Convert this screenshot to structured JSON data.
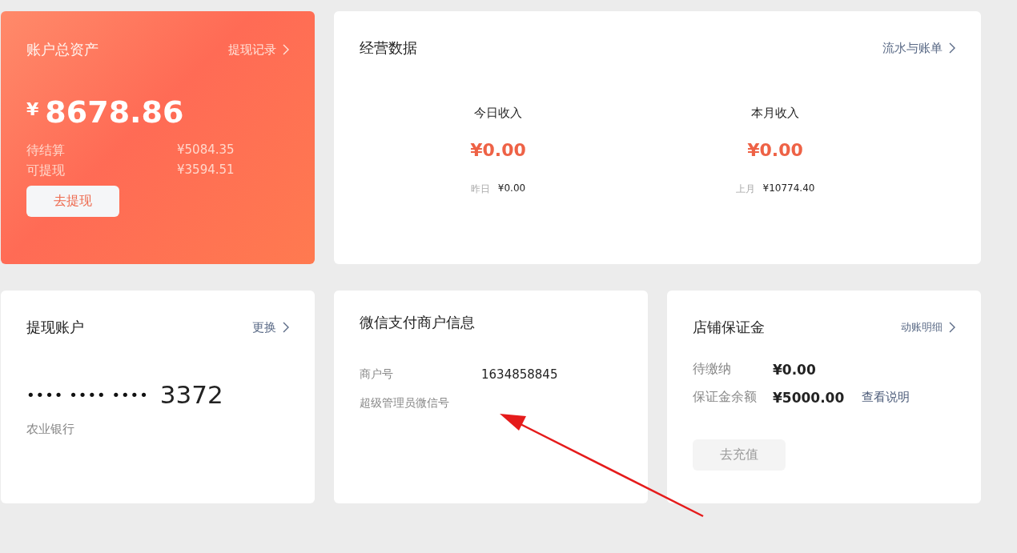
{
  "asset_card": {
    "title": "账户总资产",
    "link": "提现记录",
    "currency": "¥",
    "total": "8678.86",
    "rows": [
      {
        "label": "待结算",
        "value": "¥5084.35"
      },
      {
        "label": "可提现",
        "value": "¥3594.51"
      }
    ],
    "button": "去提现"
  },
  "business": {
    "title": "经营数据",
    "link": "流水与账单",
    "stats": [
      {
        "label": "今日收入",
        "value": "¥0.00",
        "compare_label": "昨日",
        "compare_value": "¥0.00"
      },
      {
        "label": "本月收入",
        "value": "¥0.00",
        "compare_label": "上月",
        "compare_value": "¥10774.40"
      }
    ]
  },
  "withdraw_account": {
    "title": "提现账户",
    "link": "更换",
    "masked": "•••• •••• ••••",
    "last_digits": "3372",
    "bank": "农业银行"
  },
  "merchant": {
    "title": "微信支付商户信息",
    "rows": [
      {
        "label": "商户号",
        "value": "1634858845"
      },
      {
        "label": "超级管理员微信号"
      }
    ]
  },
  "deposit": {
    "title": "店铺保证金",
    "link": "动账明细",
    "rows": [
      {
        "label": "待缴纳",
        "value": "¥0.00"
      },
      {
        "label": "保证金余额",
        "value": "¥5000.00",
        "link": "查看说明"
      }
    ],
    "button": {
      "label": "去充值",
      "disabled": true
    }
  }
}
